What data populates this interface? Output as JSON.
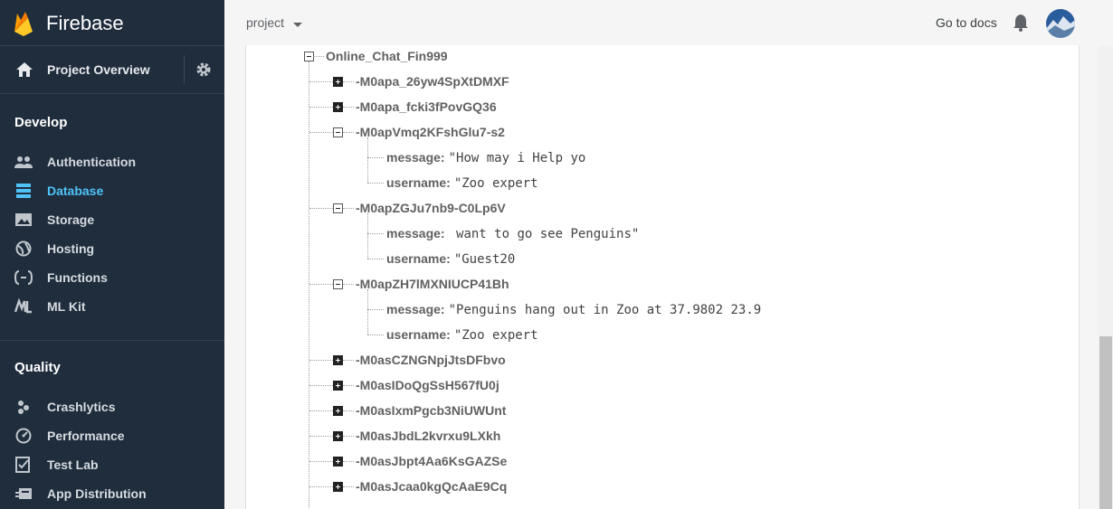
{
  "sidebar": {
    "brand": "Firebase",
    "project_overview": "Project Overview",
    "develop_title": "Develop",
    "develop_items": [
      {
        "label": "Authentication",
        "icon": "people-icon"
      },
      {
        "label": "Database",
        "icon": "database-icon",
        "active": true
      },
      {
        "label": "Storage",
        "icon": "image-icon"
      },
      {
        "label": "Hosting",
        "icon": "globe-icon"
      },
      {
        "label": "Functions",
        "icon": "functions-icon"
      },
      {
        "label": "ML Kit",
        "icon": "ml-kit-icon"
      }
    ],
    "quality_title": "Quality",
    "quality_items": [
      {
        "label": "Crashlytics",
        "icon": "bug-icon"
      },
      {
        "label": "Performance",
        "icon": "speedometer-icon"
      },
      {
        "label": "Test Lab",
        "icon": "checklist-icon"
      },
      {
        "label": "App Distribution",
        "icon": "distribution-icon"
      }
    ]
  },
  "topbar": {
    "project": "project",
    "docs": "Go to docs"
  },
  "colors": {
    "sidebar_bg": "#1f2d3d",
    "active": "#4fc3f7",
    "brand_orange": "#ffa000"
  },
  "tree": {
    "root": "Online_Chat_Fin999",
    "children": [
      {
        "key": "-M0apa_26yw4SpXtDMXF",
        "expanded": false
      },
      {
        "key": "-M0apa_fcki3fPovGQ36",
        "expanded": false
      },
      {
        "key": "-M0apVmq2KFshGlu7-s2",
        "expanded": true,
        "fields": [
          {
            "k": "message:",
            "v": "\"How may i Help yo"
          },
          {
            "k": "username:",
            "v": "\"Zoo expert"
          }
        ]
      },
      {
        "key": "-M0apZGJu7nb9-C0Lp6V",
        "expanded": true,
        "fields": [
          {
            "k": "message:",
            "v": " want to go see Penguins\""
          },
          {
            "k": "username:",
            "v": "\"Guest20"
          }
        ]
      },
      {
        "key": "-M0apZH7lMXNIUCP41Bh",
        "expanded": true,
        "fields": [
          {
            "k": "message:",
            "v": "\"Penguins hang out in Zoo at 37.9802 23.9"
          },
          {
            "k": "username:",
            "v": "\"Zoo expert"
          }
        ]
      },
      {
        "key": "-M0asCZNGNpjJtsDFbvo",
        "expanded": false
      },
      {
        "key": "-M0asIDoQgSsH567fU0j",
        "expanded": false
      },
      {
        "key": "-M0asIxmPgcb3NiUWUnt",
        "expanded": false
      },
      {
        "key": "-M0asJbdL2kvrxu9LXkh",
        "expanded": false
      },
      {
        "key": "-M0asJbpt4Aa6KsGAZSe",
        "expanded": false
      },
      {
        "key": "-M0asJcaa0kgQcAaE9Cq",
        "expanded": false
      }
    ]
  }
}
